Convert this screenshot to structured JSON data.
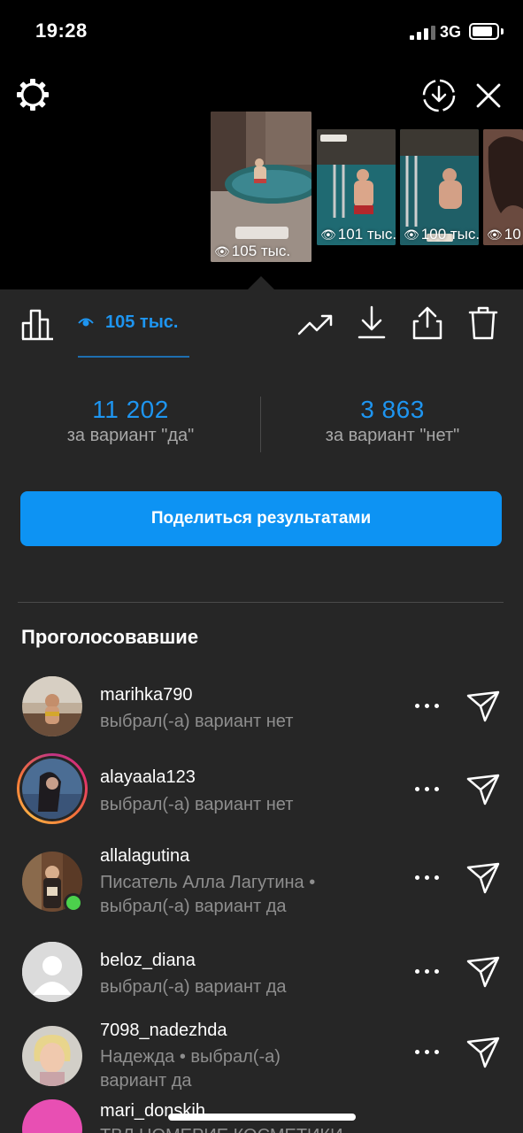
{
  "status_bar": {
    "time": "19:28",
    "network": "3G"
  },
  "thumbnails": [
    {
      "views": "105 тыс.",
      "selected": true
    },
    {
      "views": "101 тыс.",
      "selected": false
    },
    {
      "views": "100 тыс.",
      "selected": false
    },
    {
      "views": "10",
      "selected": false
    }
  ],
  "tabs": {
    "views_count": "105 тыс."
  },
  "poll": {
    "yes_count": "11 202",
    "yes_label": "за вариант \"да\"",
    "no_count": "3 863",
    "no_label": "за вариант \"нет\""
  },
  "share_button": "Поделиться результатами",
  "voters_title": "Проголосовавшие",
  "voters": [
    {
      "username": "marihka790",
      "line1": "выбрал(-а) вариант нет",
      "line2": ""
    },
    {
      "username": "alayaala123",
      "line1": "выбрал(-а) вариант нет",
      "line2": ""
    },
    {
      "username": "allalagutina",
      "line1": "Писатель Алла Лагутина •",
      "line2": "выбрал(-а) вариант да"
    },
    {
      "username": "beloz_diana",
      "line1": "выбрал(-а) вариант да",
      "line2": ""
    },
    {
      "username": "7098_nadezhda",
      "line1": "Надежда • выбрал(-а)",
      "line2": "вариант да"
    },
    {
      "username": "mari_donskih",
      "line1": "ТВЛ НОМЕРИЕ КОСМЕТИКИ",
      "line2": ""
    }
  ],
  "colors": {
    "accent": "#1e95f0",
    "button": "#0d93f3",
    "panel": "#262626"
  }
}
